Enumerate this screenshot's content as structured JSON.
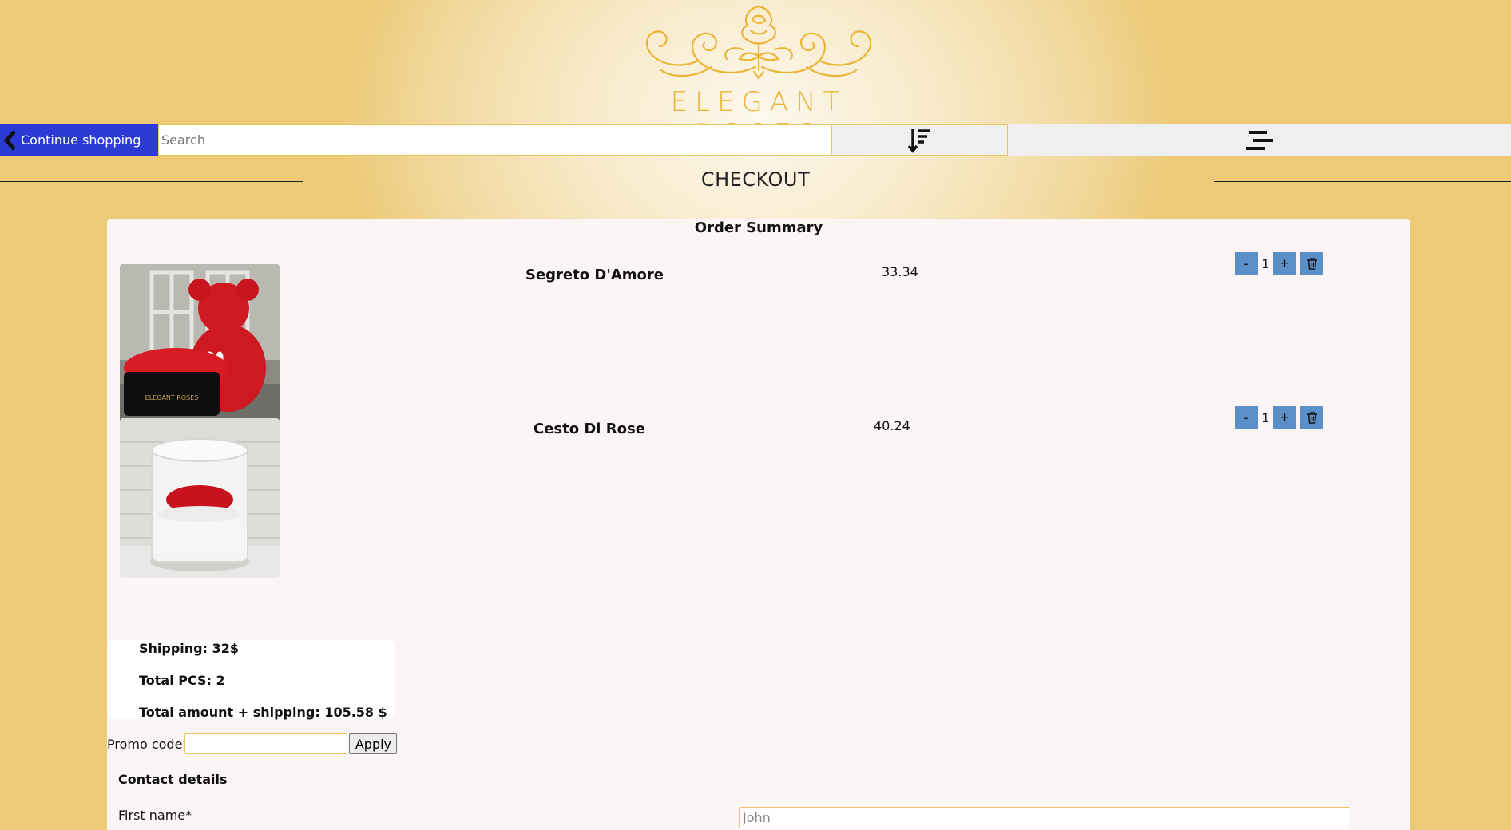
{
  "logo": {
    "text": "ELEGANT ROSES",
    "color": "#ecb436"
  },
  "toolbar": {
    "continue_label": "Continue shopping",
    "search_placeholder": "Search",
    "sort_icon": "sort-descending-icon",
    "menu_icon": "menu-icon"
  },
  "page": {
    "title": "CHECKOUT"
  },
  "summary": {
    "title": "Order Summary",
    "items": [
      {
        "name": "Segreto D'Amore",
        "price": "33.34",
        "qty": "1",
        "image": "rose-bear-heart-box"
      },
      {
        "name": "Cesto Di Rose",
        "price": "40.24",
        "qty": "1",
        "image": "rose-cylinder-box"
      }
    ],
    "buttons": {
      "minus": "-",
      "plus": "+"
    },
    "shipping": "Shipping: 32$",
    "total_pcs": "Total PCS: 2",
    "total_amount": "Total amount + shipping: 105.58 $"
  },
  "promo": {
    "label": "Promo code",
    "value": "",
    "apply_label": "Apply"
  },
  "contact": {
    "title": "Contact details",
    "first_name_label": "First name*",
    "first_name_placeholder": "John"
  },
  "colors": {
    "accent": "#2c3bd6",
    "qty_button": "#5b8fc8",
    "gold": "#ecc462"
  }
}
